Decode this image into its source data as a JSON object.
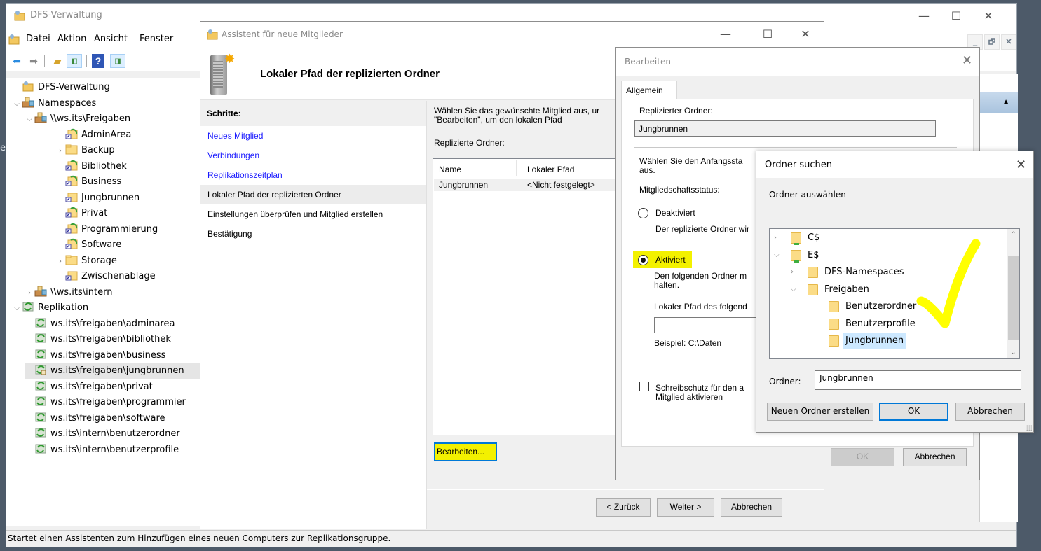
{
  "desktop": {
    "edge_char": "e"
  },
  "mmc": {
    "title": "DFS-Verwaltung",
    "menu": [
      "Datei",
      "Aktion",
      "Ansicht",
      "Fenster"
    ],
    "window_controls": {
      "minimize": "—",
      "maximize": "☐",
      "close": "✕"
    },
    "mdi_controls": {
      "minimize": "_",
      "restore": "🗗",
      "close": "✕"
    },
    "toolbar": [
      "back-icon",
      "forward-icon",
      "up-folder-icon",
      "show-hide-tree-icon",
      "help-icon",
      "show-hide-action-pane-icon"
    ],
    "tree": [
      {
        "label": "DFS-Verwaltung",
        "level": 0,
        "toggle": "",
        "icon": "dfs-management-icon"
      },
      {
        "label": "Namespaces",
        "level": 0,
        "toggle": "⌄",
        "icon": "namespaces-icon"
      },
      {
        "label": "\\\\ws.its\\Freigaben",
        "level": 1,
        "toggle": "⌄",
        "icon": "namespace-icon"
      },
      {
        "label": "AdminArea",
        "level": 2,
        "toggle": "",
        "icon": "replicated-folder-icon"
      },
      {
        "label": "Backup",
        "level": 2,
        "toggle": "›",
        "icon": "folder-icon"
      },
      {
        "label": "Bibliothek",
        "level": 2,
        "toggle": "",
        "icon": "replicated-folder-icon"
      },
      {
        "label": "Business",
        "level": 2,
        "toggle": "",
        "icon": "replicated-folder-icon"
      },
      {
        "label": "Jungbrunnen",
        "level": 2,
        "toggle": "",
        "icon": "folder-link-icon"
      },
      {
        "label": "Privat",
        "level": 2,
        "toggle": "",
        "icon": "replicated-folder-icon"
      },
      {
        "label": "Programmierung",
        "level": 2,
        "toggle": "",
        "icon": "replicated-folder-icon"
      },
      {
        "label": "Software",
        "level": 2,
        "toggle": "",
        "icon": "replicated-folder-icon"
      },
      {
        "label": "Storage",
        "level": 2,
        "toggle": "›",
        "icon": "folder-icon"
      },
      {
        "label": "Zwischenablage",
        "level": 2,
        "toggle": "",
        "icon": "folder-link-icon"
      },
      {
        "label": "\\\\ws.its\\intern",
        "level": 1,
        "toggle": "›",
        "icon": "namespace-icon"
      },
      {
        "label": "Replikation",
        "level": 0,
        "toggle": "⌄",
        "icon": "replication-icon"
      },
      {
        "label": "ws.its\\freigaben\\adminarea",
        "level": 1,
        "toggle": "",
        "icon": "replication-group-icon"
      },
      {
        "label": "ws.its\\freigaben\\bibliothek",
        "level": 1,
        "toggle": "",
        "icon": "replication-group-icon"
      },
      {
        "label": "ws.its\\freigaben\\business",
        "level": 1,
        "toggle": "",
        "icon": "replication-group-icon"
      },
      {
        "label": "ws.its\\freigaben\\jungbrunnen",
        "level": 1,
        "toggle": "",
        "icon": "replication-group-pending-icon",
        "selected": true
      },
      {
        "label": "ws.its\\freigaben\\privat",
        "level": 1,
        "toggle": "",
        "icon": "replication-group-icon"
      },
      {
        "label": "ws.its\\freigaben\\programmier",
        "level": 1,
        "toggle": "",
        "icon": "replication-group-icon"
      },
      {
        "label": "ws.its\\freigaben\\software",
        "level": 1,
        "toggle": "",
        "icon": "replication-group-icon"
      },
      {
        "label": "ws.its\\intern\\benutzerordner",
        "level": 1,
        "toggle": "",
        "icon": "replication-group-icon"
      },
      {
        "label": "ws.its\\intern\\benutzerprofile",
        "level": 1,
        "toggle": "",
        "icon": "replication-group-icon"
      }
    ],
    "action_pane": {
      "collapse_arrow": "▲"
    },
    "status": "Startet einen Assistenten zum Hinzufügen eines neuen Computers zur Replikationsgruppe."
  },
  "wizard": {
    "title": "Assistent für neue Mitglieder",
    "window_controls": {
      "minimize": "—",
      "maximize": "☐",
      "close": "✕"
    },
    "heading": "Lokaler Pfad der replizierten Ordner",
    "steps_header": "Schritte:",
    "steps": [
      {
        "label": "Neues Mitglied",
        "state": "done"
      },
      {
        "label": "Verbindungen",
        "state": "done"
      },
      {
        "label": "Replikationszeitplan",
        "state": "done"
      },
      {
        "label": "Lokaler Pfad der replizierten Ordner",
        "state": "current"
      },
      {
        "label": "Einstellungen überprüfen und Mitglied erstellen",
        "state": "pending"
      },
      {
        "label": "Bestätigung",
        "state": "pending"
      }
    ],
    "description_line1": "Wählen Sie das gewünschte Mitglied aus, ur",
    "description_line2": "\"Bearbeiten\", um den lokalen Pfad",
    "list_label": "Replizierte Ordner:",
    "columns": [
      "Name",
      "Lokaler Pfad"
    ],
    "rows": [
      {
        "name": "Jungbrunnen",
        "path": "<Nicht festgelegt>"
      }
    ],
    "edit_button": "Bearbeiten...",
    "back_button": "< Zurück",
    "next_button": "Weiter >",
    "cancel_button": "Abbrechen"
  },
  "edit_dialog": {
    "title": "Bearbeiten",
    "close": "✕",
    "tab": "Allgemein",
    "replicated_folder_label": "Replizierter Ordner:",
    "replicated_folder_value": "Jungbrunnen",
    "initial_state_line1": "Wählen Sie den Anfangssta",
    "initial_state_line2": "aus.",
    "membership_label": "Mitgliedschaftsstatus:",
    "radio_disabled": {
      "label": "Deaktiviert",
      "checked": false,
      "desc": "Der replizierte Ordner wir"
    },
    "radio_enabled": {
      "label": "Aktiviert",
      "checked": true,
      "desc1": "Den folgenden Ordner m",
      "desc2": "halten."
    },
    "local_path_label": "Lokaler Pfad des folgend",
    "local_path_value": "",
    "example": "Beispiel: C:\\Daten",
    "readonly_checkbox": {
      "line1": "Schreibschutz für den a",
      "line2": "Mitglied aktivieren",
      "checked": false
    },
    "ok_button": "OK",
    "cancel_button": "Abbrechen"
  },
  "folder_dialog": {
    "title": "Ordner suchen",
    "close": "✕",
    "subtitle": "Ordner auswählen",
    "tree": [
      {
        "label": "C$",
        "level": 0,
        "toggle": "›",
        "icon": "network-share-icon"
      },
      {
        "label": "E$",
        "level": 0,
        "toggle": "⌄",
        "icon": "network-share-icon"
      },
      {
        "label": "DFS-Namespaces",
        "level": 1,
        "toggle": "›",
        "icon": "folder-icon"
      },
      {
        "label": "Freigaben",
        "level": 1,
        "toggle": "⌄",
        "icon": "folder-icon"
      },
      {
        "label": "Benutzerordner",
        "level": 2,
        "toggle": "",
        "icon": "folder-icon"
      },
      {
        "label": "Benutzerprofile",
        "level": 2,
        "toggle": "",
        "icon": "folder-icon"
      },
      {
        "label": "Jungbrunnen",
        "level": 2,
        "toggle": "",
        "icon": "folder-icon",
        "selected": true
      }
    ],
    "scroll_up": "⌃",
    "scroll_down": "⌄",
    "folder_label": "Ordner:",
    "folder_value": "Jungbrunnen",
    "new_folder_button": "Neuen Ordner erstellen",
    "ok_button": "OK",
    "cancel_button": "Abbrechen"
  },
  "annotation": {
    "type": "checkmark",
    "color": "#ffff00"
  }
}
